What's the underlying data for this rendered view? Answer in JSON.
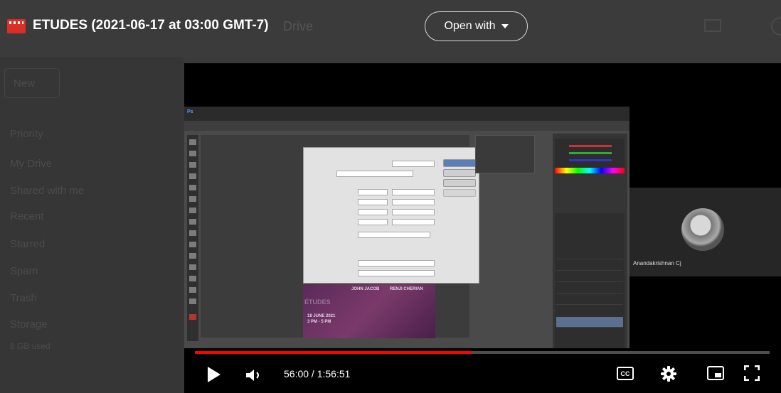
{
  "header": {
    "title": "ETUDES (2021-06-17 at 03:00 GMT-7)",
    "app_name": "Drive",
    "open_with_label": "Open with"
  },
  "sidebar": {
    "new_label": "New",
    "items": [
      "Priority",
      "My Drive",
      "Shared with me",
      "Recent",
      "Starred",
      "Spam",
      "Trash",
      "Storage"
    ],
    "storage_used": "8 GB used"
  },
  "video": {
    "participant_name": "Anandakrishnan Cj",
    "doc_title": "JOHN JACOB",
    "doc_subtitle": "RENJI CHERIAN",
    "doc_date": "18 JUNE 2021",
    "doc_time": "3 PM - 5 PM",
    "doc_word": "ÉTUDES",
    "progress_fraction": 0.4814
  },
  "controls": {
    "time_display": "56:00 / 1:56:51",
    "cc_label": "CC"
  },
  "colors": {
    "progress": "#ff0000",
    "file_icon": "#d93025",
    "background": "#3a3a3a"
  }
}
